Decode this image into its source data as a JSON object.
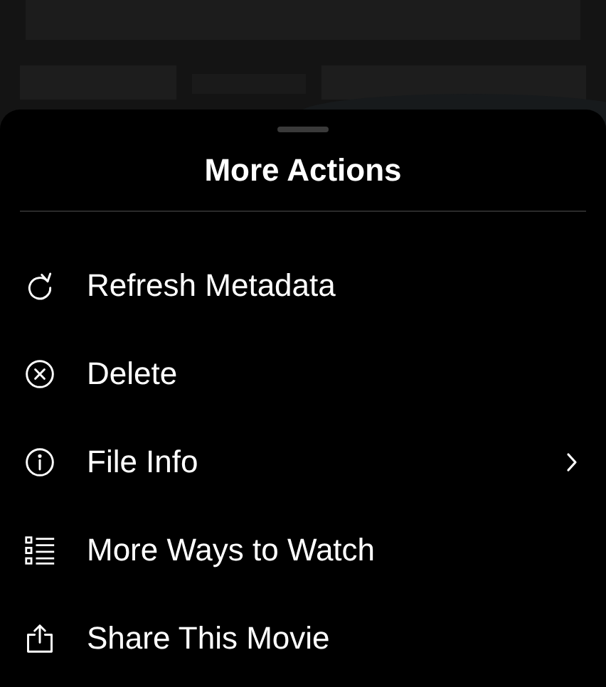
{
  "sheet": {
    "title": "More Actions",
    "items": [
      {
        "kind": "refresh",
        "label": "Refresh Metadata",
        "submenu": false
      },
      {
        "kind": "delete",
        "label": "Delete",
        "submenu": false
      },
      {
        "kind": "info",
        "label": "File Info",
        "submenu": true
      },
      {
        "kind": "list",
        "label": "More Ways to Watch",
        "submenu": false
      },
      {
        "kind": "share",
        "label": "Share This Movie",
        "submenu": false
      }
    ]
  }
}
